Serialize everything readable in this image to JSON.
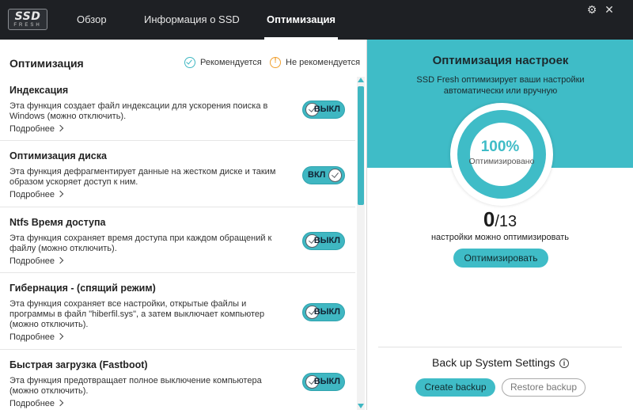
{
  "app": {
    "logo_main": "SSD",
    "logo_sub": "FRESH"
  },
  "tabs": [
    {
      "label": "Обзор"
    },
    {
      "label": "Информация о SSD"
    },
    {
      "label": "Оптимизация"
    }
  ],
  "window": {
    "settings_glyph": "⚙",
    "close_glyph": "✕",
    "settings_icon": "gear-icon",
    "close_icon": "close-icon"
  },
  "left": {
    "title": "Оптимизация",
    "legend": {
      "recommended": "Рекомендуется",
      "not_recommended": "Не рекомендуется"
    },
    "more_label": "Подробнее",
    "items": [
      {
        "title": "Индексация",
        "desc": "Эта функция создает файл индексации для ускорения поиска в Windows (можно отключить).",
        "state": "ВЫКЛ"
      },
      {
        "title": "Оптимизация диска",
        "desc": "Эта функция дефрагментирует данные на жестком диске и таким образом ускоряет доступ к ним.",
        "state": "ВКЛ"
      },
      {
        "title": "Ntfs Время доступа",
        "desc": "Эта функция сохраняет время доступа при каждом обращений к файлу (можно отключить).",
        "state": "ВЫКЛ"
      },
      {
        "title": "Гибернация - (спящий режим)",
        "desc": "Эта функция сохраняет все настройки, открытые файлы и программы в файл \"hiberfil.sys\", а затем выключает компьютер (можно отключить).",
        "state": "ВЫКЛ"
      },
      {
        "title": "Быстрая загрузка (Fastboot)",
        "desc": "Эта функция предотвращает полное выключение компьютера (можно отключить).",
        "state": "ВЫКЛ"
      }
    ]
  },
  "right": {
    "title": "Оптимизация настроек",
    "desc": "SSD Fresh оптимизирует ваши настройки автоматически или вручную",
    "percent": "100%",
    "percent_label": "Оптимизировано",
    "count": "0",
    "total": "/13",
    "count_label": "настройки можно оптимизировать",
    "optimize_button": "Оптимизировать",
    "backup_title": "Back up System Settings",
    "info_glyph": "i",
    "create_backup": "Create backup",
    "restore_backup": "Restore backup"
  },
  "colors": {
    "accent": "#3fbcc7",
    "titlebar": "#1e2024",
    "warn": "#f0a030"
  }
}
